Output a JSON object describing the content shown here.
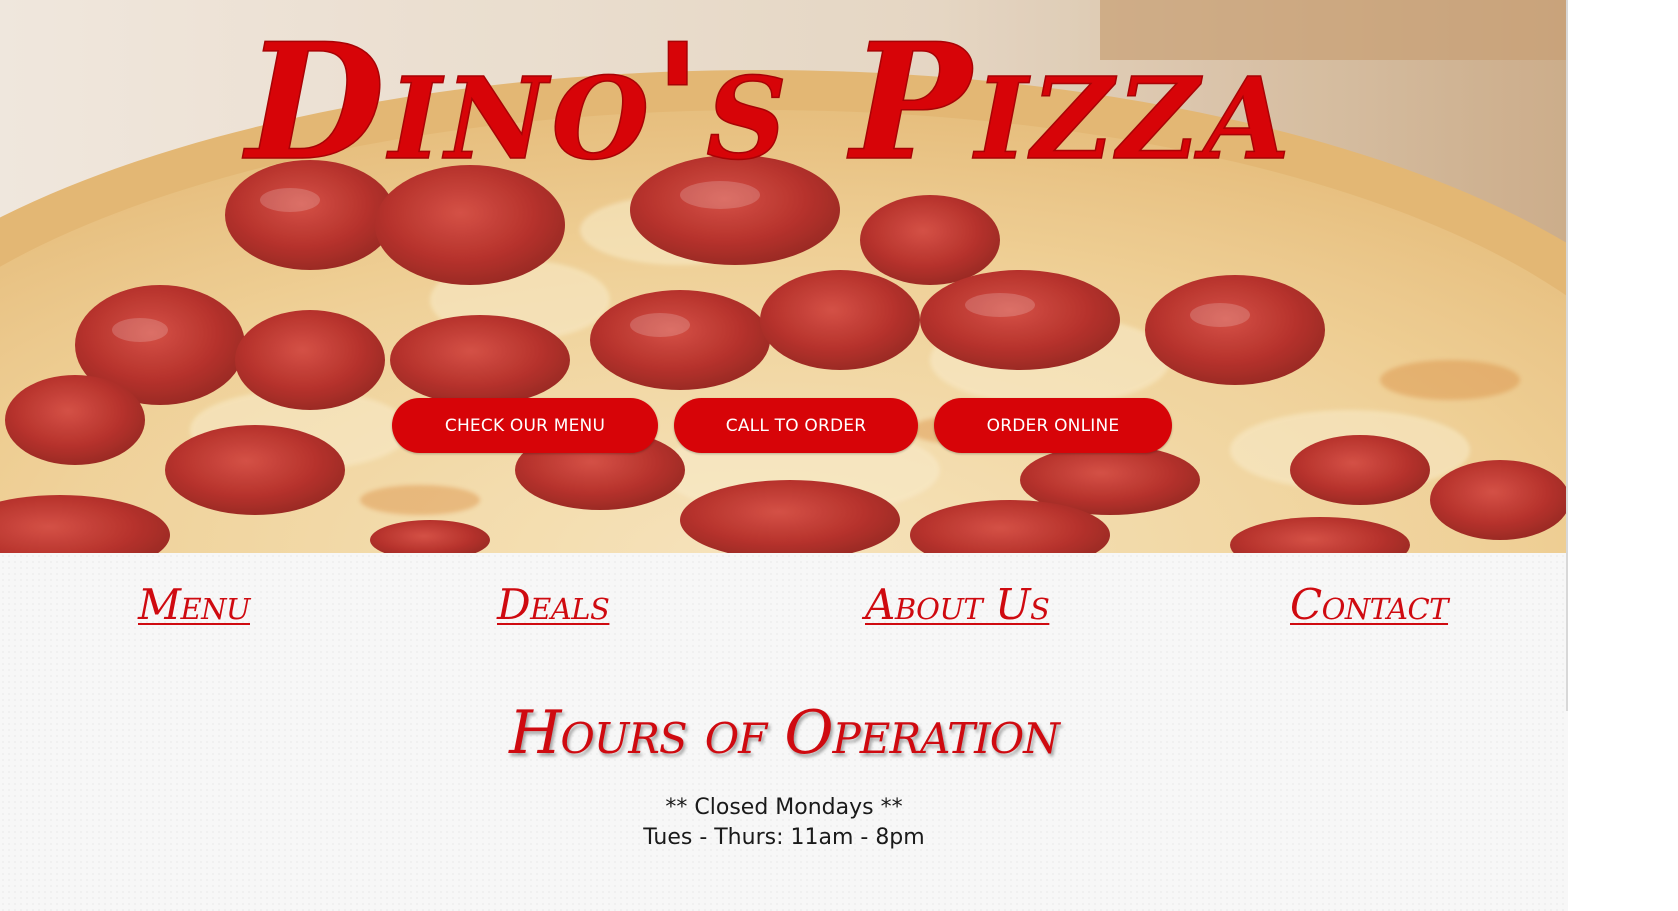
{
  "brand": {
    "title": "Dino's Pizza",
    "accent_color": "#d70408"
  },
  "hero": {
    "image_icon": "pepperoni-pizza-photo",
    "buttons": [
      {
        "label": "CHECK OUR MENU"
      },
      {
        "label": "CALL TO ORDER"
      },
      {
        "label": "ORDER ONLINE"
      }
    ]
  },
  "nav": {
    "items": [
      {
        "label": "Menu"
      },
      {
        "label": "Deals"
      },
      {
        "label": "About Us"
      },
      {
        "label": "Contact"
      }
    ]
  },
  "hours": {
    "title": "Hours of Operation",
    "lines": [
      "** Closed Mondays **",
      "Tues - Thurs: 11am - 8pm"
    ]
  }
}
